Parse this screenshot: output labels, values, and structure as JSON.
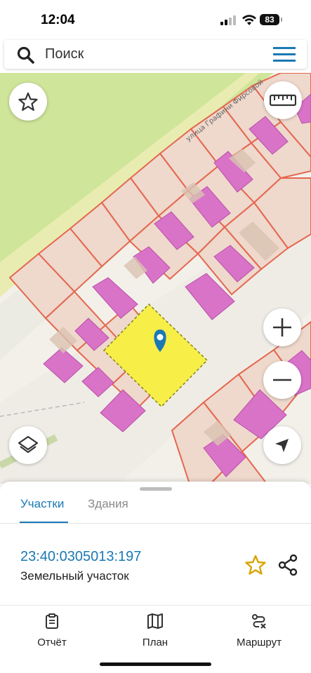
{
  "status_bar": {
    "time": "12:04",
    "battery": "83",
    "icons": [
      "signal-icon",
      "wifi-icon",
      "battery-icon"
    ]
  },
  "search": {
    "placeholder": "Поиск",
    "icons": [
      "search-icon",
      "menu-icon"
    ]
  },
  "map": {
    "street_label": "улица Графини Фирсовой",
    "controls": [
      "star-icon",
      "ruler-icon",
      "zoom-in-icon",
      "zoom-out-icon",
      "layers-icon",
      "locate-arrow-icon"
    ],
    "colors": {
      "plot_fill": "#efd8cc",
      "plot_border": "#e4674f",
      "building": "#d973c8",
      "selected_plot": "#f7ef47",
      "grass": "#cfe59a",
      "road": "#f1eee8",
      "pin": "#1a79b5"
    }
  },
  "sheet": {
    "tabs": [
      {
        "label": "Участки",
        "active": true
      },
      {
        "label": "Здания",
        "active": false
      }
    ],
    "plot": {
      "number": "23:40:0305013:197",
      "type": "Земельный участок"
    },
    "actions": [
      "star-icon",
      "share-icon"
    ]
  },
  "bottom_nav": {
    "items": [
      {
        "label": "Отчёт",
        "icon": "report-icon"
      },
      {
        "label": "План",
        "icon": "map-icon"
      },
      {
        "label": "Маршрут",
        "icon": "route-icon"
      }
    ]
  }
}
